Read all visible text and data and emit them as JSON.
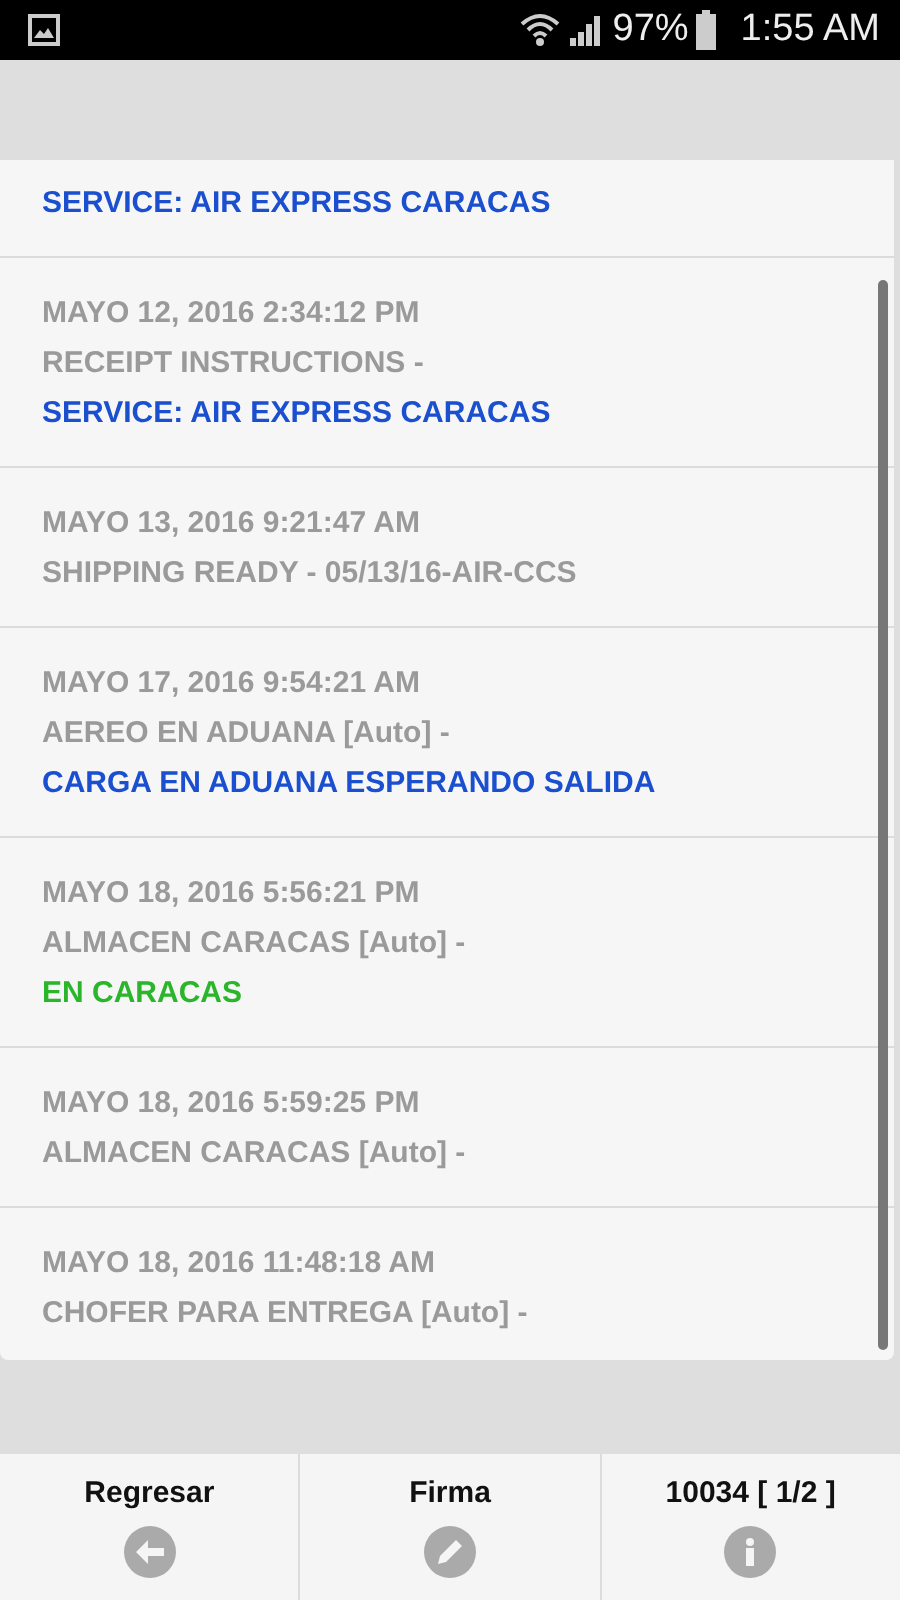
{
  "status_bar": {
    "battery": "97%",
    "time": "1:55 AM"
  },
  "entries": [
    {
      "note": "SERVICE: AIR EXPRESS CARACAS",
      "color": "#1a4fd0"
    },
    {
      "date": "MAYO 12, 2016 2:34:12 PM",
      "event": "RECEIPT INSTRUCTIONS -",
      "note": "SERVICE: AIR EXPRESS CARACAS",
      "color": "#1a4fd0"
    },
    {
      "date": "MAYO 13, 2016 9:21:47 AM",
      "event": "SHIPPING READY - 05/13/16-AIR-CCS"
    },
    {
      "date": "MAYO 17, 2016 9:54:21 AM",
      "event": "AEREO EN ADUANA [Auto] -",
      "note": "CARGA EN ADUANA ESPERANDO SALIDA",
      "color": "#1a4fd0"
    },
    {
      "date": "MAYO 18, 2016 5:56:21 PM",
      "event": "ALMACEN CARACAS [Auto] -",
      "note": "EN CARACAS",
      "color": "#2bb52b"
    },
    {
      "date": "MAYO 18, 2016 5:59:25 PM",
      "event": "ALMACEN CARACAS [Auto] -"
    },
    {
      "date": "MAYO 18, 2016 11:48:18 AM",
      "event": "CHOFER PARA ENTREGA [Auto] -"
    }
  ],
  "footer": [
    {
      "label": "Regresar",
      "kind": "back"
    },
    {
      "label": "Firma",
      "kind": "sign"
    },
    {
      "label": "10034 [ 1/2 ]",
      "kind": "info"
    }
  ]
}
